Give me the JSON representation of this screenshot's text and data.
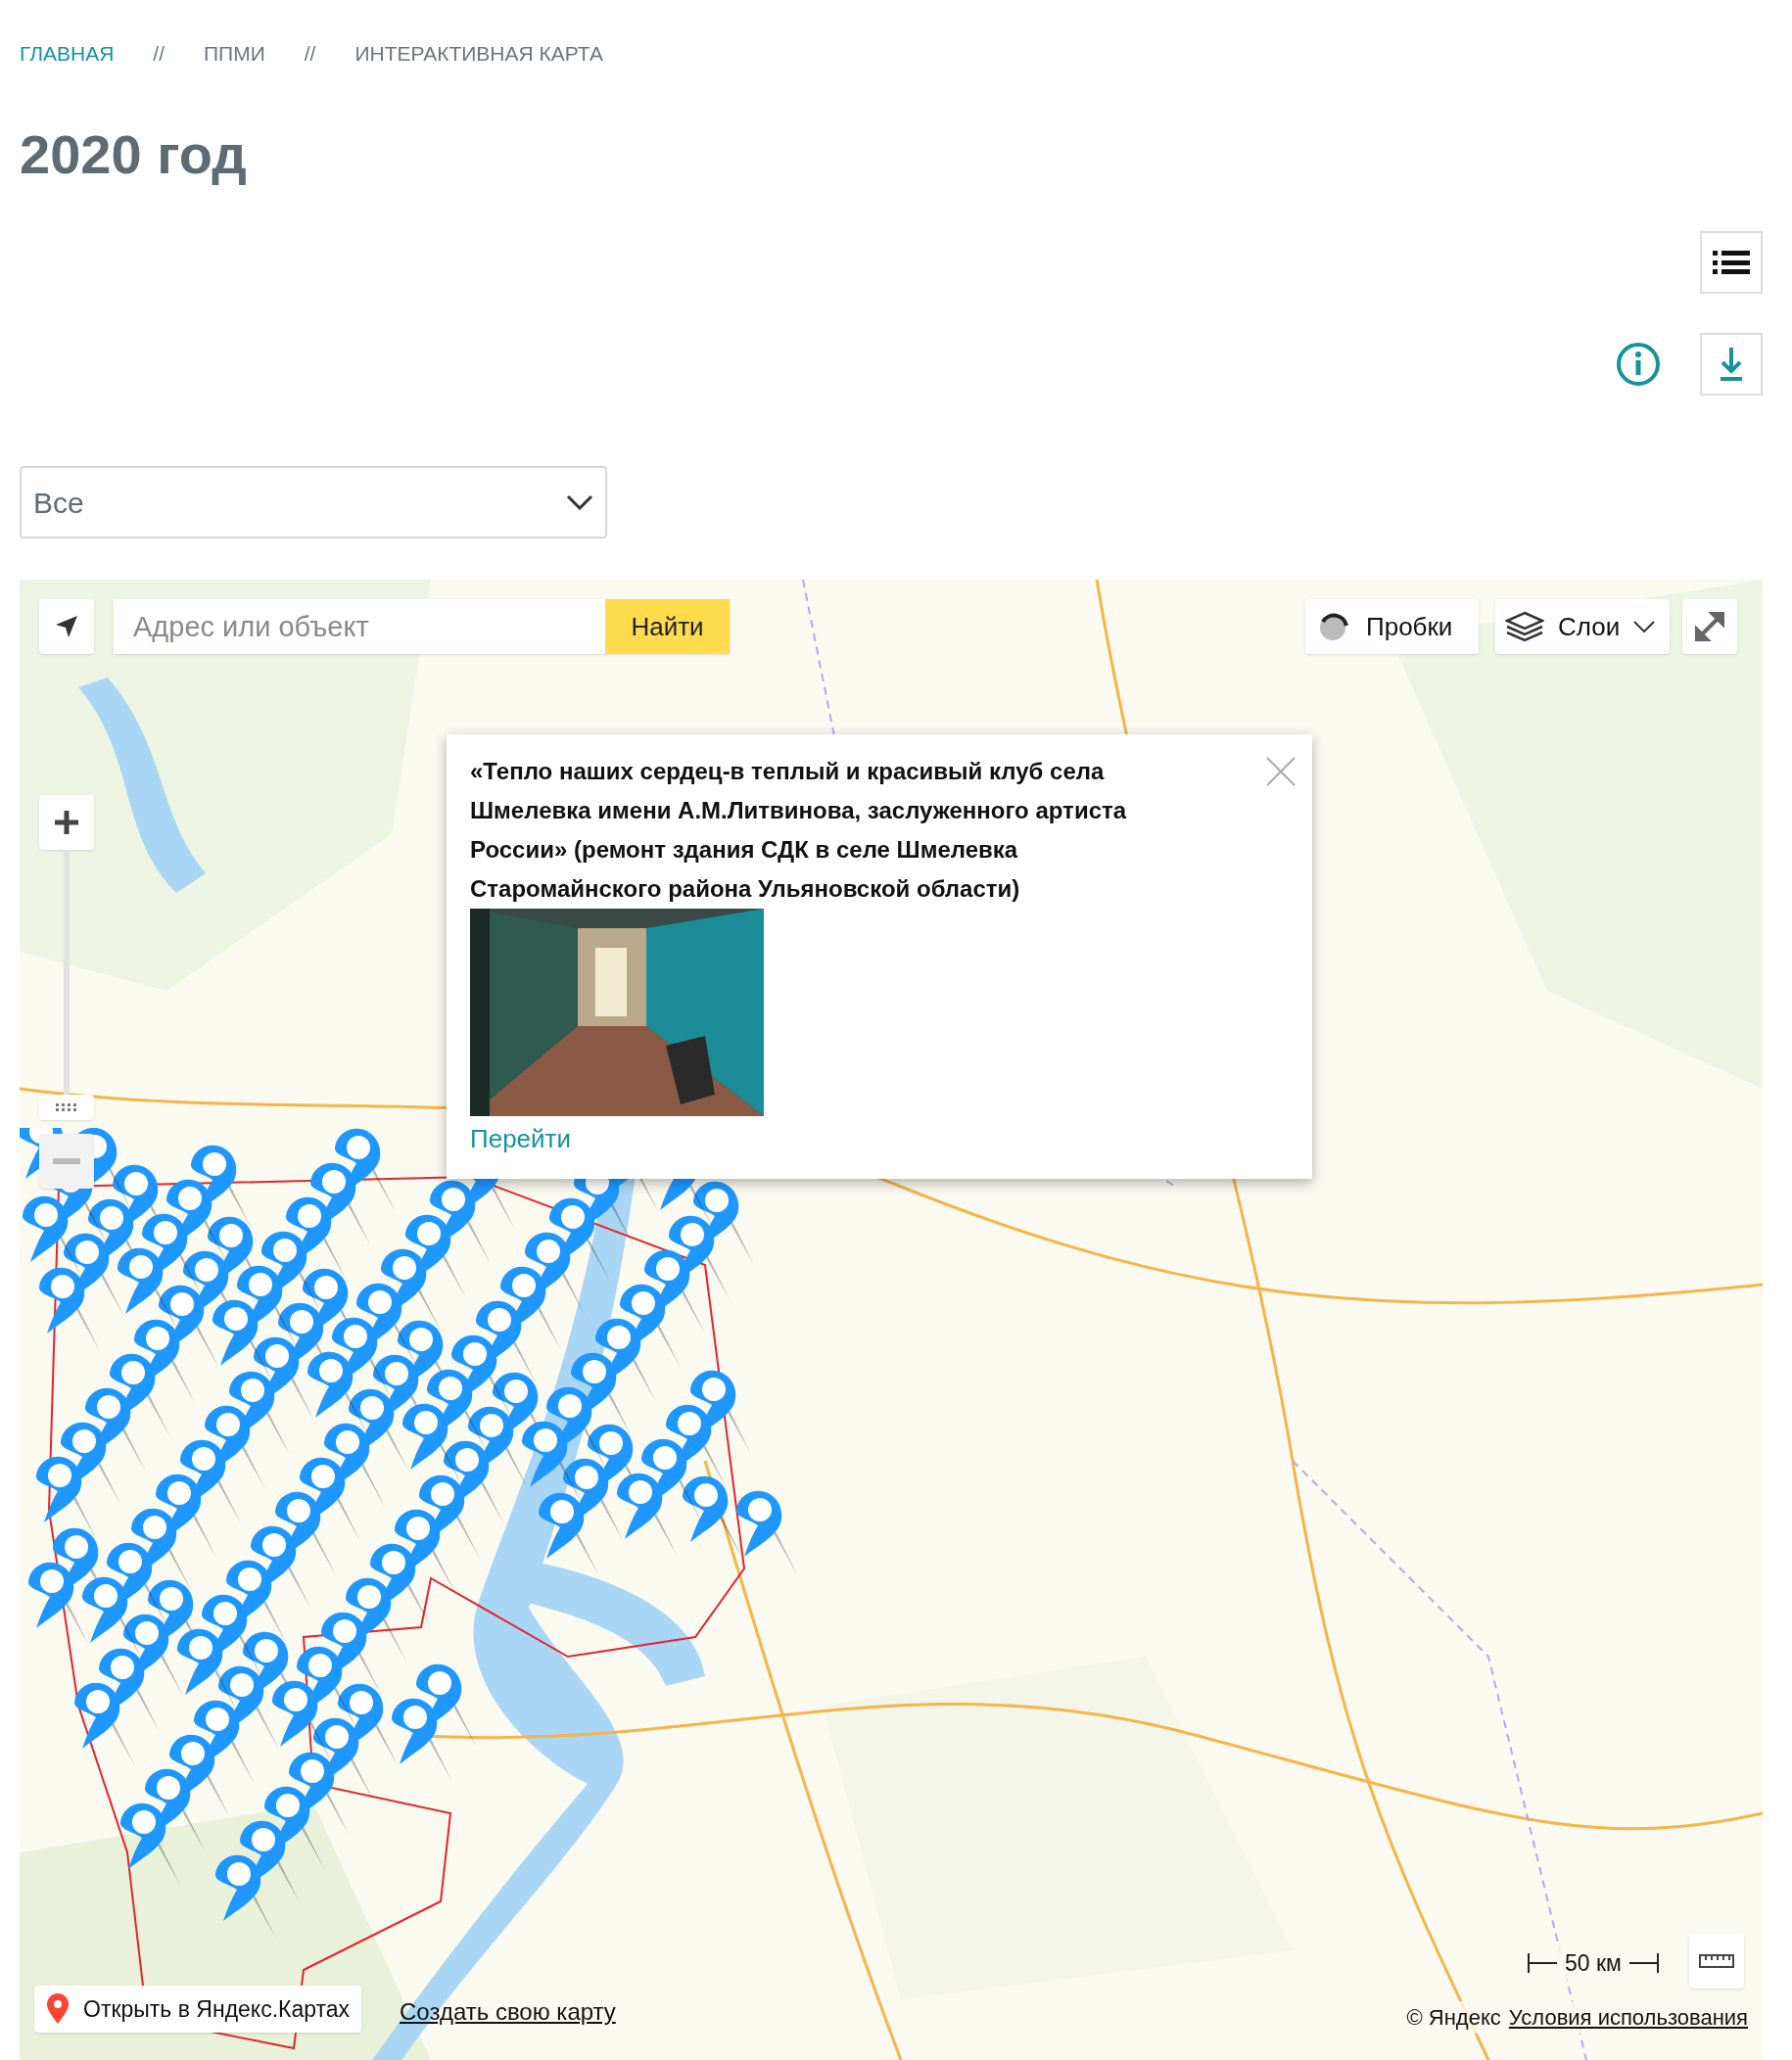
{
  "breadcrumbs": [
    {
      "label": "ГЛАВНАЯ",
      "kind": "link"
    },
    {
      "label": "//",
      "kind": "separator"
    },
    {
      "label": "ППМИ",
      "kind": "current"
    },
    {
      "label": "//",
      "kind": "separator"
    },
    {
      "label": "ИНТЕРАКТИВНАЯ КАРТА",
      "kind": "current"
    }
  ],
  "title": "2020 год",
  "filter_select": {
    "value": "Все"
  },
  "map": {
    "search": {
      "placeholder": "Адрес или объект",
      "button": "Найти"
    },
    "traffic_button": "Пробки",
    "layers_button": "Слои",
    "popup": {
      "title": "«Тепло наших сердец-в теплый и красивый клуб села Шмелевка имени А.М.Литвинова, заслуженного артиста России» (ремонт здания СДК в селе Шмелевка Старомайнского района Ульяновской области)",
      "link": "Перейти"
    },
    "scale": "50 км",
    "open_button": "Открыть в Яндекс.Картах",
    "create_link": "Создать свою карту",
    "copyright": "© Яндекс",
    "terms_link": "Условия использования"
  }
}
